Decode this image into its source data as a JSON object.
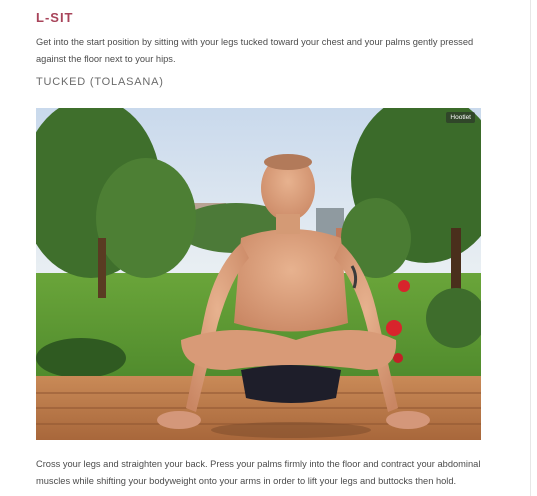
{
  "section": {
    "title": "L-SIT",
    "intro": "Get into the start position by sitting with your legs tucked toward your chest and your palms gently pressed against the floor next to your hips.",
    "variation": "TUCKED (TOLASANA)",
    "photo": {
      "badge": "Hootlet"
    },
    "instructions": "Cross your legs and straighten your back. Press your palms firmly into the floor and contract your abdominal muscles while shifting your bodyweight onto your arms in order to lift your legs and buttocks then hold."
  },
  "colors": {
    "accent": "#a8445a",
    "text": "#4c4c4c"
  }
}
